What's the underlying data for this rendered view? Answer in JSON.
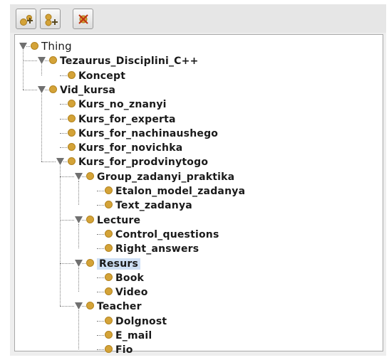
{
  "toolbar": {
    "buttons": [
      {
        "name": "add-subclass-button",
        "icon": "add-subclass-icon"
      },
      {
        "name": "add-sibling-button",
        "icon": "add-sibling-icon"
      },
      {
        "name": "delete-class-button",
        "icon": "delete-class-icon"
      }
    ]
  },
  "colors": {
    "class_dot": "#d4a338",
    "selection": "#cfe0f5",
    "add_plus": "#d4a338",
    "delete_x": "#c03010"
  },
  "tree": [
    {
      "label": "Thing",
      "depth": 0,
      "expanded": true,
      "root": true
    },
    {
      "label": "Tezaurus_Disciplini_C++",
      "depth": 1,
      "expanded": true
    },
    {
      "label": "Koncept",
      "depth": 2
    },
    {
      "label": "Vid_kursa",
      "depth": 1,
      "expanded": true
    },
    {
      "label": "Kurs_no_znanyi",
      "depth": 2
    },
    {
      "label": "Kurs_for_experta",
      "depth": 2
    },
    {
      "label": "Kurs_for_nachinaushego",
      "depth": 2
    },
    {
      "label": "Kurs_for_novichka",
      "depth": 2
    },
    {
      "label": "Kurs_for_prodvinytogo",
      "depth": 2,
      "expanded": true
    },
    {
      "label": "Group_zadanyi_praktika",
      "depth": 3,
      "expanded": true
    },
    {
      "label": "Etalon_model_zadanya",
      "depth": 4
    },
    {
      "label": "Text_zadanya",
      "depth": 4
    },
    {
      "label": "Lecture",
      "depth": 3,
      "expanded": true
    },
    {
      "label": "Control_questions",
      "depth": 4
    },
    {
      "label": "Right_answers",
      "depth": 4
    },
    {
      "label": "Resurs",
      "depth": 3,
      "expanded": true,
      "selected": true
    },
    {
      "label": "Book",
      "depth": 4
    },
    {
      "label": "Video",
      "depth": 4
    },
    {
      "label": "Teacher",
      "depth": 3,
      "expanded": true
    },
    {
      "label": "Dolgnost",
      "depth": 4
    },
    {
      "label": "E_mail",
      "depth": 4
    },
    {
      "label": "Fio",
      "depth": 4
    }
  ]
}
